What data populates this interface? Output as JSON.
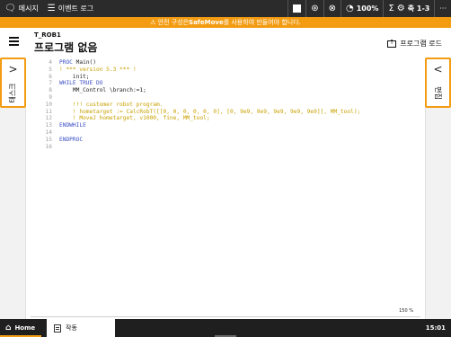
{
  "topbar": {
    "messages_label": "메시지",
    "events_label": "이벤트 로그",
    "speed_label": "100%",
    "axes_label": "축 1-3",
    "more_label": "···"
  },
  "banner": {
    "prefix": "⚠ 안전 구성은 ",
    "highlight": "SafeMove",
    "suffix": "를 사용하여 만들어야 합니다."
  },
  "header": {
    "task_name": "T_ROB1",
    "title": "프로그램 없음",
    "load_label": "프로그램 로드"
  },
  "left_tab": {
    "label": "태스크"
  },
  "right_tab": {
    "label": "편집"
  },
  "code_lines": [
    {
      "ln": "4",
      "parts": [
        {
          "t": "PROC ",
          "c": "kw"
        },
        {
          "t": "Main()",
          "c": "tx"
        }
      ]
    },
    {
      "ln": "5",
      "parts": [
        {
          "t": "! *** version 5.3 *** !",
          "c": "cm"
        }
      ]
    },
    {
      "ln": "6",
      "parts": [
        {
          "t": "    init;",
          "c": "tx"
        }
      ]
    },
    {
      "ln": "7",
      "parts": [
        {
          "t": "WHILE TRUE DO",
          "c": "kw"
        }
      ]
    },
    {
      "ln": "8",
      "parts": [
        {
          "t": "    MM_Control \\branch:=1;",
          "c": "tx"
        }
      ]
    },
    {
      "ln": "9",
      "parts": [
        {
          "t": "",
          "c": "tx"
        }
      ]
    },
    {
      "ln": "10",
      "parts": [
        {
          "t": "    !!! customer robot program.",
          "c": "cm"
        }
      ]
    },
    {
      "ln": "11",
      "parts": [
        {
          "t": "    ! hometarget := CalcRobT([[0, 0, 0, 0, 0, 0], [0, 9e9, 9e9, 9e9, 9e9, 9e9]], MM_tool);",
          "c": "cm"
        }
      ]
    },
    {
      "ln": "12",
      "parts": [
        {
          "t": "    ! MoveJ hometarget, v1000, fine, MM_tool;",
          "c": "cm"
        }
      ]
    },
    {
      "ln": "13",
      "parts": [
        {
          "t": "ENDWHILE",
          "c": "kw"
        }
      ]
    },
    {
      "ln": "14",
      "parts": [
        {
          "t": "",
          "c": "tx"
        }
      ]
    },
    {
      "ln": "15",
      "parts": [
        {
          "t": "ENDPROC",
          "c": "kw"
        }
      ]
    },
    {
      "ln": "16",
      "parts": [
        {
          "t": "",
          "c": "tx"
        }
      ]
    }
  ],
  "editor": {
    "zoom": "150 %"
  },
  "taskbar": {
    "home_label": "Home",
    "task_label": "작동",
    "clock": "15:01"
  },
  "colors": {
    "accent": "#f39c12",
    "keyword": "#3b4fc4",
    "comment": "#c8a000",
    "topbar": "#2b2b2b"
  },
  "icons": {
    "messages": "chat-bubble-icon",
    "events": "list-icon",
    "stop": "stop-square-icon",
    "robot": "robot-arm-icon",
    "motor": "motor-icon",
    "speed": "speedometer-icon",
    "sigma": "sigma-icon",
    "jog": "jog-axes-icon"
  }
}
